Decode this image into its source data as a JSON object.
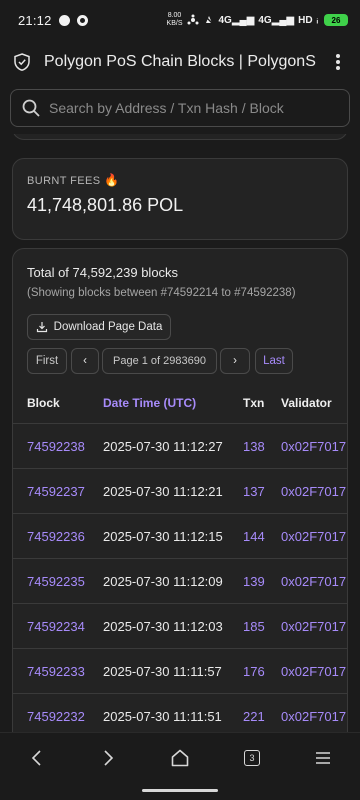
{
  "status_bar": {
    "time": "21:12",
    "speed_value": "8.00",
    "speed_unit": "KB/S",
    "signal_1": "4G",
    "signal_2": "4G",
    "hd_label": "HD",
    "battery_level": "26"
  },
  "header": {
    "title": "Polygon PoS Chain Blocks | PolygonScan"
  },
  "search": {
    "placeholder": "Search by Address / Txn Hash / Block"
  },
  "fees": {
    "label": "BURNT FEES",
    "icon": "fire",
    "value": "41,748,801.86 POL"
  },
  "blocks": {
    "total": "Total of 74,592,239 blocks",
    "showing": "(Showing blocks between #74592214 to #74592238)",
    "download_label": "Download Page Data",
    "pagination": {
      "first_label": "First",
      "prev_symbol": "‹",
      "page_text": "Page 1 of 2983690",
      "next_symbol": "›",
      "last_label": "Last"
    },
    "columns": [
      "Block",
      "Date Time (UTC)",
      "Txn",
      "Validator"
    ],
    "rows": [
      {
        "block": "74592238",
        "datetime": "2025-07-30 11:12:27",
        "txn": "138",
        "validator": "0x02F7017"
      },
      {
        "block": "74592237",
        "datetime": "2025-07-30 11:12:21",
        "txn": "137",
        "validator": "0x02F7017"
      },
      {
        "block": "74592236",
        "datetime": "2025-07-30 11:12:15",
        "txn": "144",
        "validator": "0x02F7017"
      },
      {
        "block": "74592235",
        "datetime": "2025-07-30 11:12:09",
        "txn": "139",
        "validator": "0x02F7017"
      },
      {
        "block": "74592234",
        "datetime": "2025-07-30 11:12:03",
        "txn": "185",
        "validator": "0x02F7017"
      },
      {
        "block": "74592233",
        "datetime": "2025-07-30 11:11:57",
        "txn": "176",
        "validator": "0x02F7017"
      },
      {
        "block": "74592232",
        "datetime": "2025-07-30 11:11:51",
        "txn": "221",
        "validator": "0x02F7017"
      }
    ]
  },
  "nav": {
    "tab_count": "3"
  },
  "colors": {
    "accent": "#a78bfa",
    "background": "#1b1b1b",
    "card": "#232323",
    "battery": "#3fd14a"
  }
}
